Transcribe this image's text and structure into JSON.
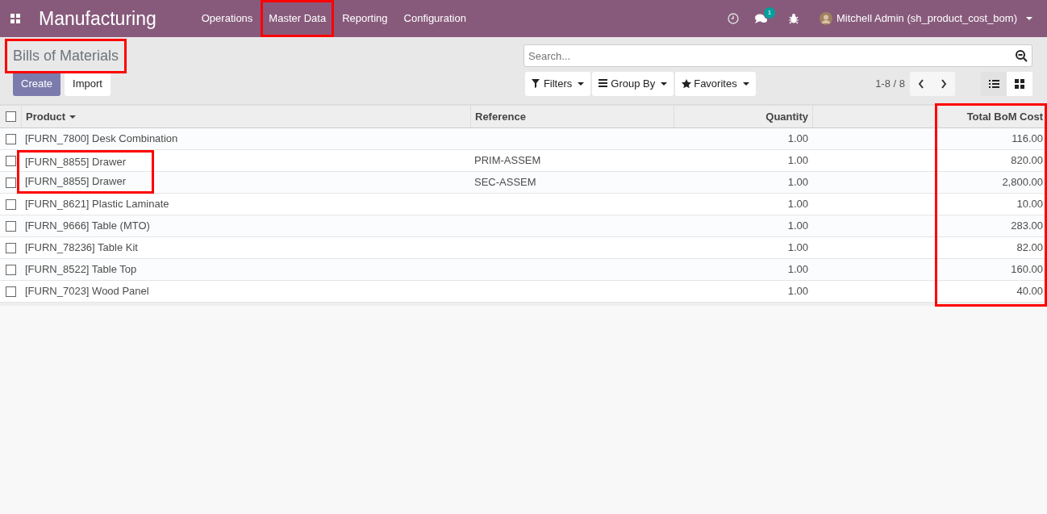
{
  "app_title": "Manufacturing",
  "menu": [
    {
      "label": "Operations",
      "highlighted": false
    },
    {
      "label": "Master Data",
      "highlighted": true
    },
    {
      "label": "Reporting",
      "highlighted": false
    },
    {
      "label": "Configuration",
      "highlighted": false
    }
  ],
  "systray": {
    "message_count": "1",
    "user": "Mitchell Admin (sh_product_cost_bom)"
  },
  "breadcrumb": {
    "text": "Bills of Materials",
    "highlighted": true
  },
  "buttons": [
    "Create",
    "Import"
  ],
  "search": {
    "placeholder": "Search..."
  },
  "filters": [
    "Filters",
    "Group By",
    "Favorites"
  ],
  "pager": "1-8 / 8",
  "views": [
    {
      "kind": "list",
      "selected": true
    },
    {
      "kind": "kanban",
      "selected": false
    }
  ],
  "table": {
    "select_all": {
      "checked": false
    },
    "columns": [
      {
        "label": "Product",
        "sorted": true,
        "highlighted": false
      },
      {
        "label": "Reference",
        "sorted": false,
        "highlighted": false
      },
      {
        "label": "Quantity",
        "sorted": false,
        "highlighted": false
      },
      {
        "label": "Total BoM Cost",
        "sorted": false,
        "highlighted": true
      }
    ],
    "rows": [
      {
        "checked": false,
        "product_highlighted": false,
        "cells": [
          "[FURN_7800] Desk Combination",
          "",
          "1.00",
          "116.00"
        ]
      },
      {
        "checked": false,
        "product_highlighted": true,
        "cells": [
          "[FURN_8855] Drawer",
          "PRIM-ASSEM",
          "1.00",
          "820.00"
        ]
      },
      {
        "checked": false,
        "product_highlighted": true,
        "cells": [
          "[FURN_8855] Drawer",
          "SEC-ASSEM",
          "1.00",
          "2,800.00"
        ]
      },
      {
        "checked": false,
        "product_highlighted": false,
        "cells": [
          "[FURN_8621] Plastic Laminate",
          "",
          "1.00",
          "10.00"
        ]
      },
      {
        "checked": false,
        "product_highlighted": false,
        "cells": [
          "[FURN_9666] Table (MTO)",
          "",
          "1.00",
          "283.00"
        ]
      },
      {
        "checked": false,
        "product_highlighted": false,
        "cells": [
          "[FURN_78236] Table Kit",
          "",
          "1.00",
          "82.00"
        ]
      },
      {
        "checked": false,
        "product_highlighted": false,
        "cells": [
          "[FURN_8522] Table Top",
          "",
          "1.00",
          "160.00"
        ]
      },
      {
        "checked": false,
        "product_highlighted": false,
        "cells": [
          "[FURN_7023] Wood Panel",
          "",
          "1.00",
          "40.00"
        ]
      }
    ]
  }
}
